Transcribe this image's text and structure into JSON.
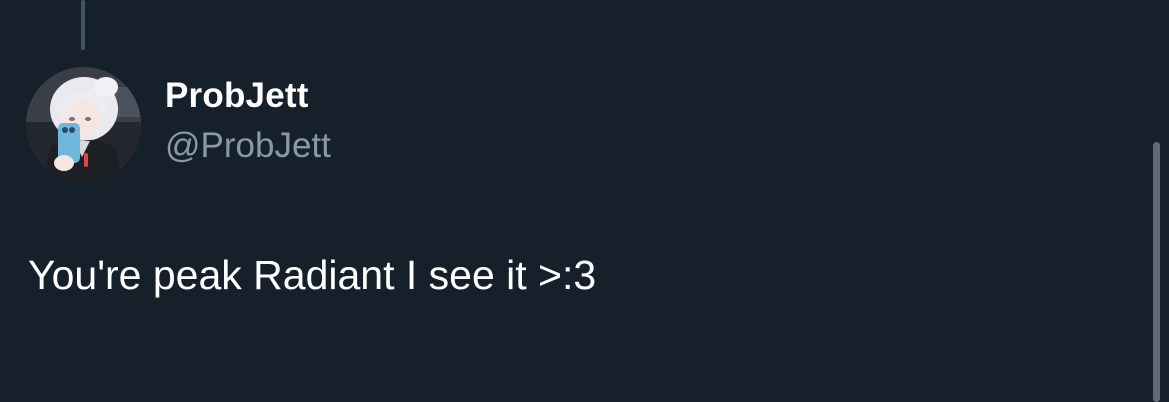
{
  "tweet": {
    "author": {
      "display_name": "ProbJett",
      "handle": "@ProbJett",
      "avatar_icon": "anime-character-avatar"
    },
    "text": "You're peak Radiant I see it >:3"
  },
  "theme": {
    "background": "#15202b",
    "primary_text": "#ffffff",
    "secondary_text": "#8b98a5",
    "thread_line": "#425466"
  }
}
